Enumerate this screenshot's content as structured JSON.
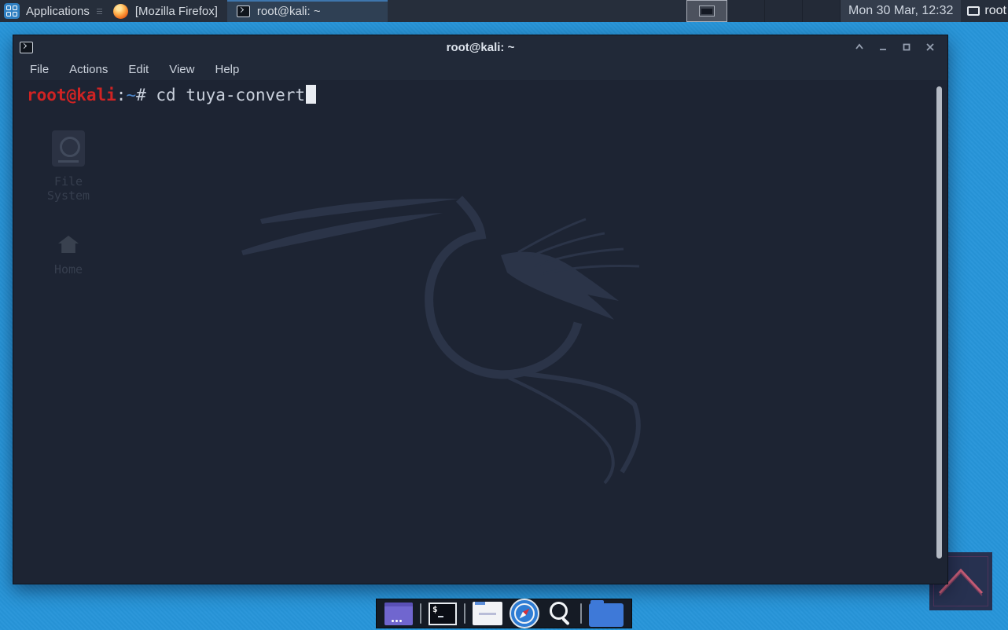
{
  "top_panel": {
    "applications_label": "Applications",
    "tasks": [
      {
        "label": "[Mozilla Firefox]",
        "icon": "firefox-icon",
        "active": false
      },
      {
        "label": "root@kali: ~",
        "icon": "terminal-icon",
        "active": true
      }
    ],
    "workspace_count": 4,
    "active_workspace": 1,
    "clock": "Mon 30 Mar, 12:32",
    "user_label": "root"
  },
  "terminal_window": {
    "title": "root@kali: ~",
    "window_controls": [
      "shade",
      "minimize",
      "maximize",
      "close"
    ],
    "menu": [
      "File",
      "Actions",
      "Edit",
      "View",
      "Help"
    ],
    "prompt": {
      "user_host": "root@kali",
      "separator": ":",
      "path": "~",
      "symbol": "# ",
      "command": "cd tuya-convert",
      "cursor": "block"
    },
    "colors": {
      "background": "#1d2433",
      "prompt_user": "#d02323",
      "prompt_path": "#4c85c8",
      "text": "#c9d0dc",
      "watermark": "#2b3448"
    }
  },
  "desktop": {
    "wallpaper_color": "#2795d9",
    "icons": [
      {
        "label": "File System"
      },
      {
        "label": "Home"
      }
    ],
    "corner_logo": "kali-chevron-logo"
  },
  "dock": {
    "items": [
      "windows",
      "terminal",
      "text-editor",
      "web-browser",
      "search",
      "file-manager"
    ]
  }
}
